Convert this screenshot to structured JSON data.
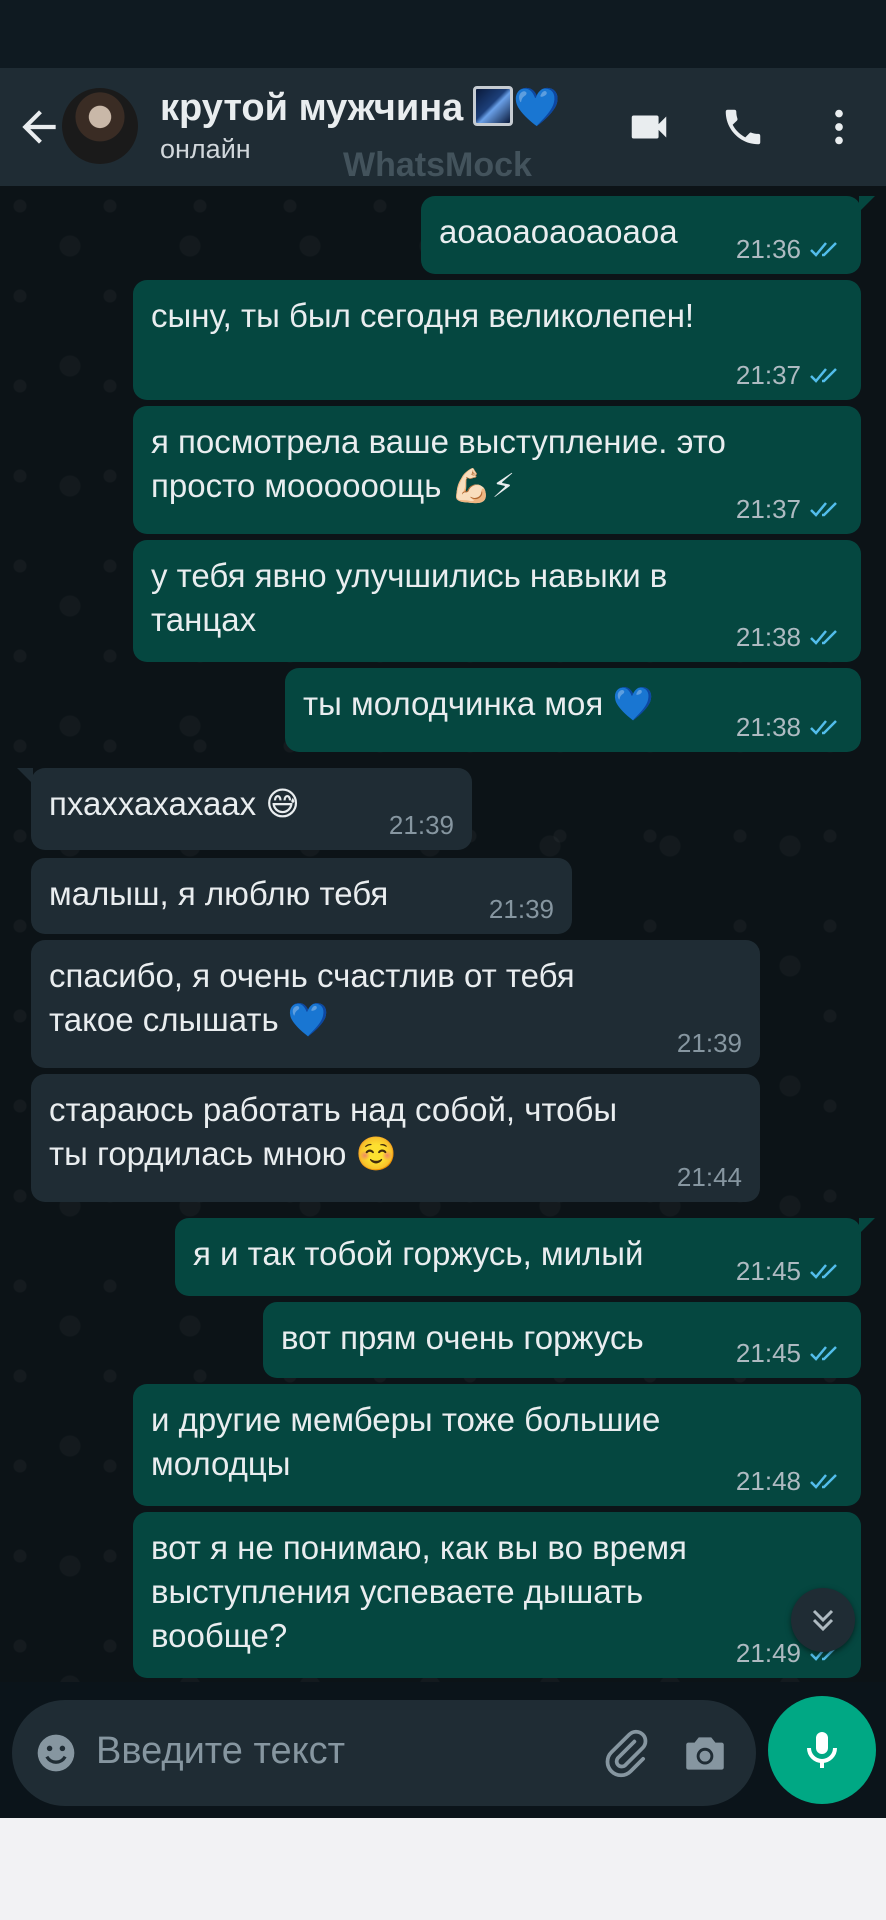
{
  "header": {
    "contact_name": "крутой мужчина",
    "name_emoji": "💙",
    "status": "онлайн",
    "watermark": "WhatsMock"
  },
  "messages": [
    {
      "dir": "out",
      "text": "аоаоаоаоаоаоа",
      "time": "21:36"
    },
    {
      "dir": "out",
      "text": "сыну, ты был сегодня великолепен!",
      "time": "21:37"
    },
    {
      "dir": "out",
      "text": "я посмотрела ваше выступление. это\nпросто моооооощь 💪🏻⚡",
      "time": "21:37"
    },
    {
      "dir": "out",
      "text": "у тебя явно улучшились навыки в\nтанцах",
      "time": "21:38"
    },
    {
      "dir": "out",
      "text": "ты молодчинка моя 💙",
      "time": "21:38"
    },
    {
      "dir": "in",
      "text": "пхаххахахаах 😅",
      "time": "21:39"
    },
    {
      "dir": "in",
      "text": "малыш, я люблю тебя",
      "time": "21:39"
    },
    {
      "dir": "in",
      "text": "спасибо, я очень счастлив от тебя\nтакое слышать 💙",
      "time": "21:39"
    },
    {
      "dir": "in",
      "text": "стараюсь работать над собой, чтобы\nты гордилась мною ☺️",
      "time": "21:44"
    },
    {
      "dir": "out",
      "text": "я и так тобой горжусь, милый",
      "time": "21:45"
    },
    {
      "dir": "out",
      "text": "вот прям очень горжусь",
      "time": "21:45"
    },
    {
      "dir": "out",
      "text": "и другие мемберы тоже большие\nмолодцы",
      "time": "21:48"
    },
    {
      "dir": "out",
      "text": "вот я не понимаю, как вы во время\nвыступления успеваете дышать\nвообще?",
      "time": "21:49"
    }
  ],
  "composer": {
    "placeholder": "Введите текст"
  },
  "colors": {
    "outgoing_bubble": "#054740",
    "incoming_bubble": "#1f2c34",
    "read_ticks": "#53bdeb",
    "accent": "#00a884"
  }
}
